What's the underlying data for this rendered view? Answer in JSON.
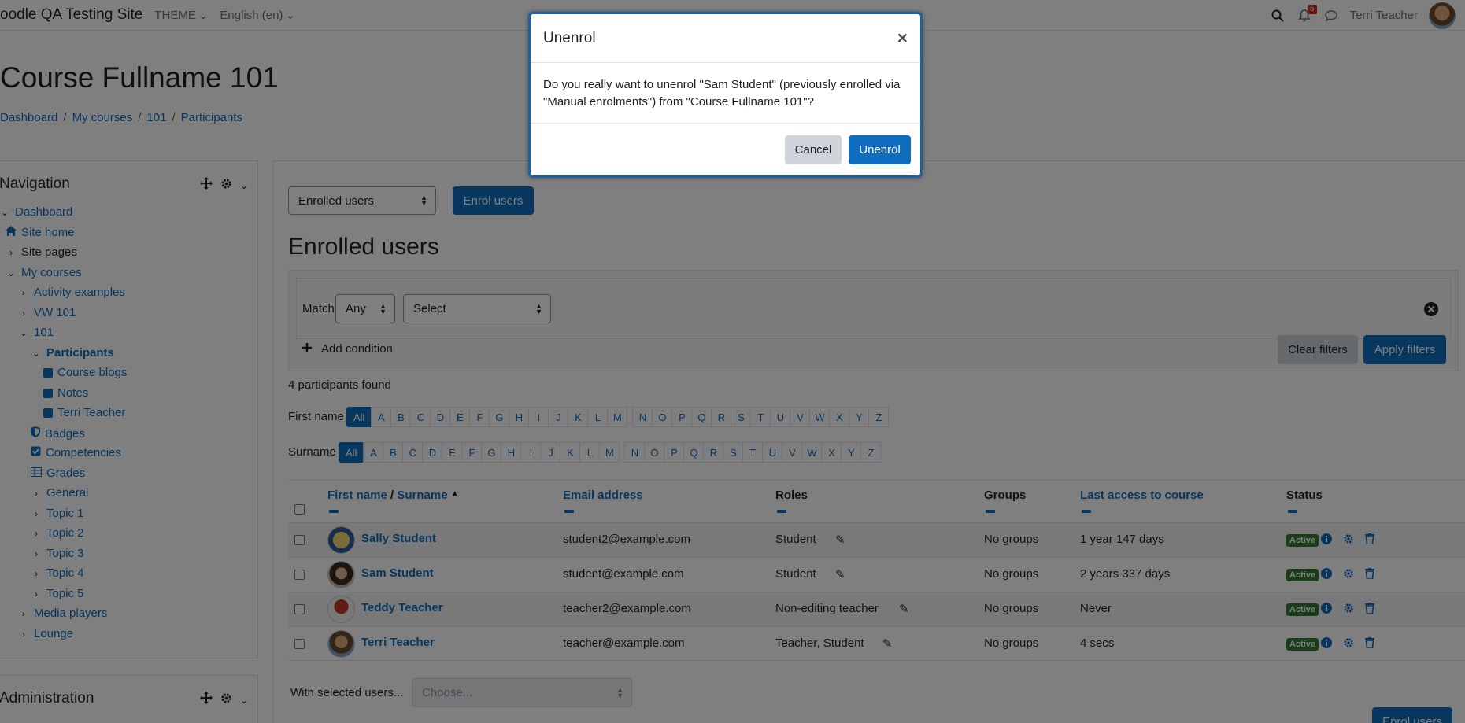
{
  "navbar": {
    "brand": "oodle QA Testing Site",
    "theme_label": "THEME",
    "language_label": "English (en)",
    "notification_count": "5",
    "user_name": "Terri Teacher"
  },
  "page": {
    "title": "Course Fullname 101",
    "breadcrumb": [
      "Dashboard",
      "My courses",
      "101",
      "Participants"
    ]
  },
  "navigation_block": {
    "title": "Navigation",
    "items": [
      {
        "label": "Dashboard"
      },
      {
        "label": "Site home"
      },
      {
        "label": "Site pages"
      },
      {
        "label": "My courses"
      },
      {
        "label": "Activity examples"
      },
      {
        "label": "VW 101"
      },
      {
        "label": "101"
      },
      {
        "label": "Participants"
      },
      {
        "label": "Course blogs"
      },
      {
        "label": "Notes"
      },
      {
        "label": "Terri Teacher"
      },
      {
        "label": "Badges"
      },
      {
        "label": "Competencies"
      },
      {
        "label": "Grades"
      },
      {
        "label": "General"
      },
      {
        "label": "Topic 1"
      },
      {
        "label": "Topic 2"
      },
      {
        "label": "Topic 3"
      },
      {
        "label": "Topic 4"
      },
      {
        "label": "Topic 5"
      },
      {
        "label": "Media players"
      },
      {
        "label": "Lounge"
      }
    ]
  },
  "admin_block": {
    "title": "Administration"
  },
  "main": {
    "enrolment_select": "Enrolled users",
    "enrol_button": "Enrol users",
    "heading": "Enrolled users",
    "filter": {
      "match_label": "Match",
      "match_value": "Any",
      "select_value": "Select",
      "add_condition": "Add condition",
      "clear_filters": "Clear filters",
      "apply_filters": "Apply filters"
    },
    "participants_found": "4 participants found",
    "first_name_label": "First name",
    "surname_label": "Surname",
    "letters": [
      "All",
      "A",
      "B",
      "C",
      "D",
      "E",
      "F",
      "G",
      "H",
      "I",
      "J",
      "K",
      "L",
      "M",
      "N",
      "O",
      "P",
      "Q",
      "R",
      "S",
      "T",
      "U",
      "V",
      "W",
      "X",
      "Y",
      "Z"
    ],
    "table": {
      "headers": {
        "first_name": "First name",
        "slash": " / ",
        "surname": "Surname",
        "email": "Email address",
        "roles": "Roles",
        "groups": "Groups",
        "last_access": "Last access to course",
        "status": "Status"
      },
      "rows": [
        {
          "name": "Sally Student",
          "email": "student2@example.com",
          "roles": "Student",
          "groups": "No groups",
          "last_access": "1 year 147 days",
          "status": "Active"
        },
        {
          "name": "Sam Student",
          "email": "student@example.com",
          "roles": "Student",
          "groups": "No groups",
          "last_access": "2 years 337 days",
          "status": "Active"
        },
        {
          "name": "Teddy Teacher",
          "email": "teacher2@example.com",
          "roles": "Non-editing teacher",
          "groups": "No groups",
          "last_access": "Never",
          "status": "Active"
        },
        {
          "name": "Terri Teacher",
          "email": "teacher@example.com",
          "roles": "Teacher, Student",
          "groups": "No groups",
          "last_access": "4 secs",
          "status": "Active"
        }
      ]
    },
    "with_selected_label": "With selected users...",
    "with_selected_placeholder": "Choose...",
    "enrol_bottom_button": "Enrol users"
  },
  "modal": {
    "title": "Unenrol",
    "close_symbol": "×",
    "body": "Do you really want to unenrol \"Sam Student\" (previously enrolled via \"Manual enrolments\") from \"Course Fullname 101\"?",
    "cancel_label": "Cancel",
    "confirm_label": "Unenrol"
  },
  "colors": {
    "primary": "#0f6cbf",
    "active_badge": "#357a32",
    "notification": "#ca3120"
  },
  "icons": [
    "search-icon",
    "bell-icon",
    "chat-icon",
    "home-icon",
    "move-icon",
    "gear-icon",
    "chevron-down-icon",
    "badge-icon",
    "competencies-icon",
    "grades-icon",
    "plus-icon",
    "close-circle-icon",
    "pencil-icon",
    "info-icon",
    "cog-icon",
    "trash-icon",
    "sort-up-icon"
  ]
}
